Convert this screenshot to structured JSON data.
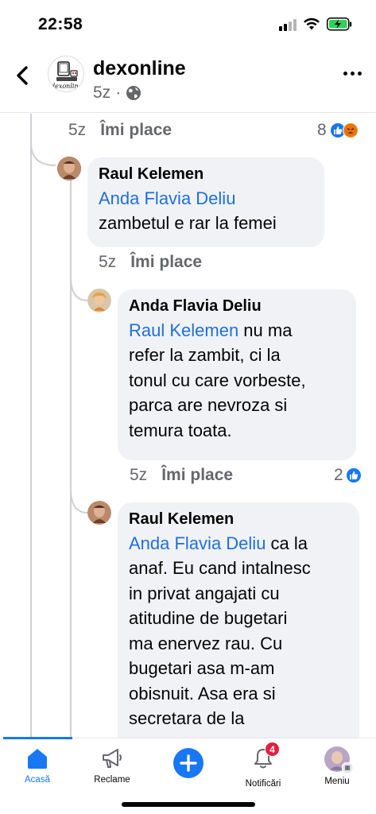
{
  "status_bar": {
    "time": "22:58"
  },
  "header": {
    "page_name": "dexonline",
    "meta_time": "5z",
    "meta_sep": "·",
    "logo_text": "dexonline"
  },
  "comments": [
    {
      "time": "5z",
      "like_label": "Îmi place",
      "reaction_count": "8"
    },
    {
      "author": "Raul Kelemen",
      "mention": "Anda Flavia Deliu",
      "text_lines": [
        "zambetul e rar la femei"
      ],
      "time": "5z",
      "like_label": "Îmi place"
    },
    {
      "author": "Anda Flavia Deliu",
      "mention": "Raul Kelemen",
      "text_lines": [
        " nu ma",
        "refer la zambit, ci la",
        "tonul cu care vorbeste,",
        "parca are nevroza si",
        "temura toata."
      ],
      "time": "5z",
      "like_label": "Îmi place",
      "reaction_count": "2"
    },
    {
      "author": "Raul Kelemen",
      "mention": "Anda Flavia Deliu",
      "text_lines": [
        " ca la",
        "anaf. Eu cand intalnesc",
        "in privat angajati cu",
        "atitudine de bugetari",
        "ma enervez rau. Cu",
        "bugetari asa m-am",
        "obisnuit. Asa era si",
        "secretara de la"
      ]
    }
  ],
  "bottom_nav": {
    "items": [
      {
        "label": "Acasă",
        "icon": "home-icon",
        "active": true
      },
      {
        "label": "Reclame",
        "icon": "megaphone-icon"
      },
      {
        "label": "",
        "icon": "create-plus-icon"
      },
      {
        "label": "Notificări",
        "icon": "bell-icon",
        "badge": "4"
      },
      {
        "label": "Meniu",
        "icon": "profile-menu-icon"
      }
    ]
  },
  "colors": {
    "accent": "#1877f2",
    "mention": "#216fdb",
    "muted": "#65676b",
    "bubble": "#f0f2f5",
    "badge": "#e41e3f"
  }
}
